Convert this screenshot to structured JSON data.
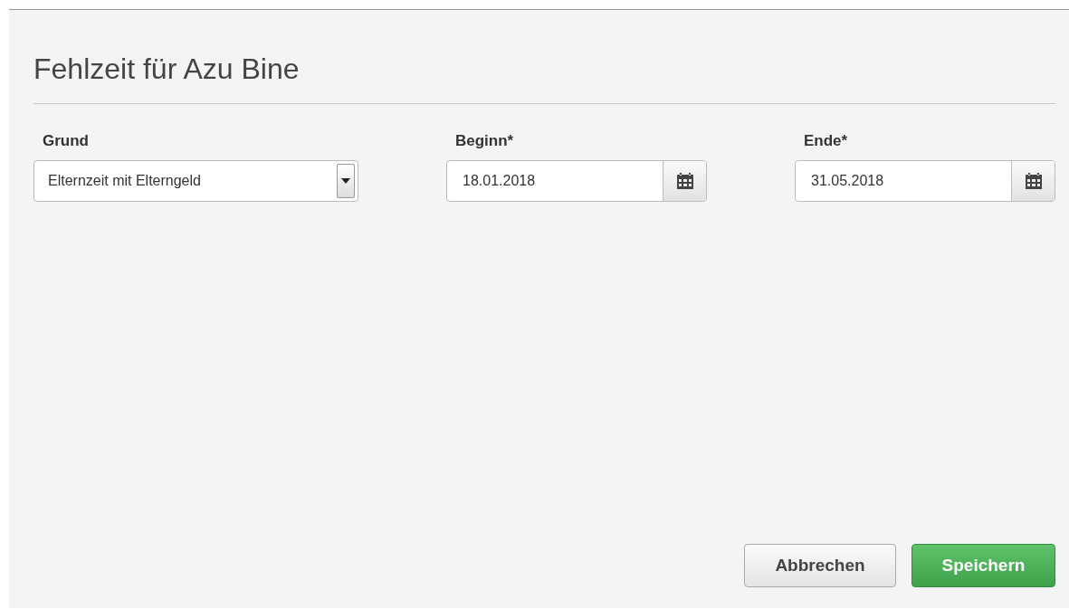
{
  "dialog": {
    "title": "Fehlzeit für Azu Bine"
  },
  "fields": [
    {
      "kind": "select",
      "label": "Grund",
      "value": "Elternzeit mit Elterngeld"
    },
    {
      "kind": "date",
      "label": "Beginn*",
      "value": "18.01.2018"
    },
    {
      "kind": "date",
      "label": "Ende*",
      "value": "31.05.2018"
    }
  ],
  "buttons": [
    {
      "kind": "default",
      "label": "Abbrechen"
    },
    {
      "kind": "primary",
      "label": "Speichern"
    }
  ]
}
